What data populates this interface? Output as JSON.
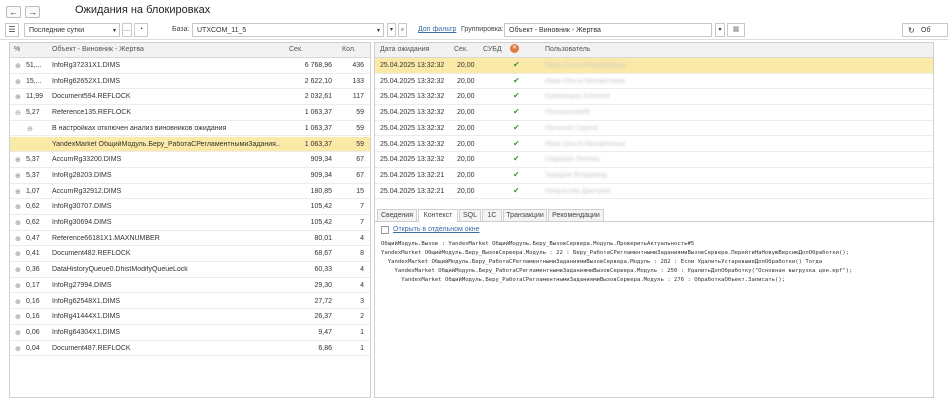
{
  "window": {
    "title": "Ожидания на блокировках",
    "back": "←",
    "forward": "→"
  },
  "toolbar": {
    "period": "Последние сутки",
    "base_label": "База:",
    "base_value": "UTXCOM_11_5",
    "filter_link": "Доп фильтр",
    "group_label": "Группировка:",
    "group_value": "Объект - Виновник - Жертва",
    "refresh_label": "Об"
  },
  "left_table": {
    "columns": [
      "%",
      "Объект - Виновник - Жертва",
      "Сек.",
      "Кол."
    ],
    "rows": [
      {
        "pct": "51,...",
        "name": "InfoRg37231X1.DIMS",
        "sec": "6 768,96",
        "cnt": "436",
        "exp": "⊕"
      },
      {
        "pct": "15,...",
        "name": "InfoRg62652X1.DIMS",
        "sec": "2 622,10",
        "cnt": "133",
        "exp": "⊕"
      },
      {
        "pct": "11,99",
        "name": "Document594.REFLOCK",
        "sec": "2 032,61",
        "cnt": "117",
        "exp": "⊕"
      },
      {
        "pct": "5,27",
        "name": "Reference135.REFLOCK",
        "sec": "1 063,37",
        "cnt": "59",
        "exp": "⊖"
      },
      {
        "pct": "",
        "name": "В настройках отключен анализ виновников ожидания",
        "sec": "1 063,37",
        "cnt": "59",
        "exp": "⊖"
      },
      {
        "pct": "",
        "name": "YandexMarket ОбщийМодуль.Беру_РаботаСРегламентнымиЗадания...",
        "sec": "1 063,37",
        "cnt": "59",
        "exp": ""
      },
      {
        "pct": "5,37",
        "name": "AccumRg33200.DIMS",
        "sec": "909,34",
        "cnt": "67",
        "exp": "⊕"
      },
      {
        "pct": "5,37",
        "name": "InfoRg28203.DIMS",
        "sec": "909,34",
        "cnt": "67",
        "exp": "⊕"
      },
      {
        "pct": "1,07",
        "name": "AccumRg32912.DIMS",
        "sec": "180,85",
        "cnt": "15",
        "exp": "⊕"
      },
      {
        "pct": "0,62",
        "name": "InfoRg30707.DIMS",
        "sec": "105,42",
        "cnt": "7",
        "exp": "⊕"
      },
      {
        "pct": "0,62",
        "name": "InfoRg30694.DIMS",
        "sec": "105,42",
        "cnt": "7",
        "exp": "⊕"
      },
      {
        "pct": "0,47",
        "name": "Reference66181X1.MAXNUMBER",
        "sec": "80,01",
        "cnt": "4",
        "exp": "⊕"
      },
      {
        "pct": "0,41",
        "name": "Document482.REFLOCK",
        "sec": "68,67",
        "cnt": "8",
        "exp": "⊕"
      },
      {
        "pct": "0,36",
        "name": "DataHistoryQueue0.DhistModifyQueueLock",
        "sec": "60,33",
        "cnt": "4",
        "exp": "⊕"
      },
      {
        "pct": "0,17",
        "name": "InfoRg27994.DIMS",
        "sec": "29,30",
        "cnt": "4",
        "exp": "⊕"
      },
      {
        "pct": "0,16",
        "name": "InfoRg62548X1.DIMS",
        "sec": "27,72",
        "cnt": "3",
        "exp": "⊕"
      },
      {
        "pct": "0,16",
        "name": "InfoRg41444X1.DIMS",
        "sec": "26,37",
        "cnt": "2",
        "exp": "⊕"
      },
      {
        "pct": "0,06",
        "name": "InfoRg64304X1.DIMS",
        "sec": "9,47",
        "cnt": "1",
        "exp": "⊕"
      },
      {
        "pct": "0,04",
        "name": "Document487.REFLOCK",
        "sec": "6,86",
        "cnt": "1",
        "exp": "⊕"
      }
    ]
  },
  "right_table": {
    "columns": [
      "Дата ожидания",
      "Сек.",
      "СУБД",
      "Пользователь"
    ],
    "rows": [
      {
        "date": "25.04.2025 13:32:32",
        "sec": "20,00",
        "user": "Иван Ольга Михайловна"
      },
      {
        "date": "25.04.2025 13:32:32",
        "sec": "20,00",
        "user": "Иван Ольга Михайловна"
      },
      {
        "date": "25.04.2025 13:32:32",
        "sec": "20,00",
        "user": "Компанцев Алексей"
      },
      {
        "date": "25.04.2025 13:32:32",
        "sec": "20,00",
        "user": "Полыхалов88"
      },
      {
        "date": "25.04.2025 13:32:32",
        "sec": "20,00",
        "user": "Наталий Сергей"
      },
      {
        "date": "25.04.2025 13:32:32",
        "sec": "20,00",
        "user": "Иван Ольга Михайловна"
      },
      {
        "date": "25.04.2025 13:32:32",
        "sec": "20,00",
        "user": "Сидоров Любовь"
      },
      {
        "date": "25.04.2025 13:32:21",
        "sec": "20,00",
        "user": "Захаров Владимир"
      },
      {
        "date": "25.04.2025 13:32:21",
        "sec": "20,00",
        "user": "Некрасова Дмитрий"
      }
    ],
    "check": "✔"
  },
  "tabs": [
    "Сведения",
    "Контекст",
    "SQL",
    "1С",
    "Транзакции",
    "Рекомендации"
  ],
  "context": {
    "open_link": "Открыть в отдельном окне",
    "lines": [
      "ОбщийМодуль.Вызов : YandexMarket ОбщийМодуль.Беру_ВызовСервера.Модуль.ПроверитьАктуальность#5",
      "YandexMarket ОбщийМодуль.Беру_ВызовСервера.Модуль : 22 : Беру_РаботаСРегламентнымиЗаданиямиВызовСервера.ПерейтиНаНовуюВерсиюДопОбработки();",
      "  YandexMarket ОбщийМодуль.Беру_РаботаСРегламентнымиЗаданиямиВызовСервера.Модуль : 282 : Если УдалитьУстаревшиеДопОбработки() Тогда",
      "    YandexMarket ОбщийМодуль.Беру_РаботаСРегламентнымиЗаданиямиВызовСервера.Модуль : 250 : УдалитьДопОбработку(\"Основная выгрузка цен.epf\");",
      "      YandexMarket ОбщийМодуль.Беру_РаботаСРегламентнымиЗаданиямиВызовСервера.Модуль : 276 : ОбработкаОбъект.Записать();"
    ]
  },
  "colors": {
    "selection": "#fbe9a7",
    "link": "#3a6ea5",
    "check": "#3a9a3a"
  }
}
